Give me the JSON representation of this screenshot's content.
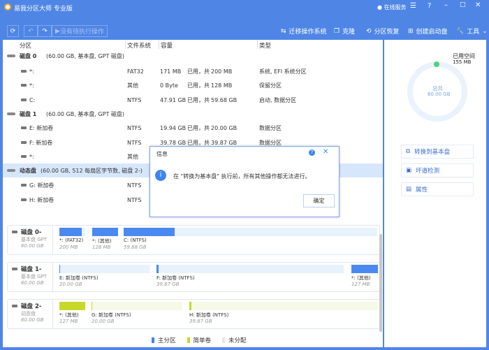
{
  "app": {
    "title": "易我分区大师 专业版",
    "online_service": "在线服务"
  },
  "toolbar": {
    "pending": "没有待执行操作",
    "migrate": "迁移操作系统",
    "clone": "克隆",
    "recover": "分区恢复",
    "bootdisk": "创建启动盘",
    "tools": "工具"
  },
  "columns": [
    "分区",
    "文件系统",
    "容量",
    "类型"
  ],
  "rows": [
    {
      "kind": "disk",
      "name": "磁盘 0",
      "info": "(60.00 GB, 基本盘, GPT 磁盘)"
    },
    {
      "kind": "part",
      "name": "*:",
      "fs": "FAT32",
      "used": "171 MB",
      "mid": "已用，共",
      "total": "200 MB",
      "type": "系统, EFI 系统分区"
    },
    {
      "kind": "part",
      "name": "*:",
      "fs": "其他",
      "used": "0 Byte",
      "mid": "已用，共",
      "total": "128 MB",
      "type": "保留分区"
    },
    {
      "kind": "part",
      "name": "C:",
      "fs": "NTFS",
      "used": "47.91 GB",
      "mid": "已用，共",
      "total": "59.68 GB",
      "type": "启动, 数据分区"
    },
    {
      "kind": "disk",
      "name": "磁盘 1",
      "info": "(60.00 GB, 基本盘, GPT 磁盘)"
    },
    {
      "kind": "part",
      "name": "E: 新加卷",
      "fs": "NTFS",
      "used": "19.94 GB",
      "mid": "已用，共",
      "total": "20.00 GB",
      "type": "数据分区"
    },
    {
      "kind": "part",
      "name": "F: 新加卷",
      "fs": "NTFS",
      "used": "39.78 GB",
      "mid": "已用，共",
      "total": "39.87 GB",
      "type": "数据分区"
    },
    {
      "kind": "part",
      "name": "*:",
      "fs": "其他",
      "used": "",
      "mid": "",
      "total": "",
      "type": ""
    },
    {
      "kind": "disk",
      "name": "动态盘",
      "info": "(60.00 GB, 512 每扇区字节数, 磁盘 2-)",
      "selected": true
    },
    {
      "kind": "part",
      "name": "G: 新加卷",
      "fs": "NTFS",
      "used": "",
      "mid": "",
      "total": "",
      "type": ""
    },
    {
      "kind": "part",
      "name": "H: 新加卷",
      "fs": "NTFS",
      "used": "",
      "mid": "",
      "total": "",
      "type": ""
    }
  ],
  "disks": [
    {
      "name": "磁盘 0-",
      "type": "基本盘 GPT",
      "size": "60.00 GB",
      "segs": [
        {
          "label": "*: (FAT32)",
          "size": "200 MB",
          "color": "#4a8af0",
          "bg": "#e8f2fd",
          "fill": 0.86
        },
        {
          "label": "*: (其他)",
          "size": "128 MB",
          "color": "#4a8af0",
          "bg": "#e8f2fd",
          "fill": 1
        },
        {
          "label": "C: (NTFS)",
          "size": "59.68 GB",
          "color": "#4a8af0",
          "bg": "#e8f2fd",
          "fill": 0.2
        }
      ]
    },
    {
      "name": "磁盘 1-",
      "type": "基本盘 GPT",
      "size": "60.00 GB",
      "segs": [
        {
          "label": "E: 新加卷 (NTFS)",
          "size": "20.00 GB",
          "color": "#4a8af0",
          "bg": "#e8f2fd",
          "fill": 0.01
        },
        {
          "label": "F: 新加卷 (NTFS)",
          "size": "39.87 GB",
          "color": "#4a8af0",
          "bg": "#e8f2fd",
          "fill": 0.01
        },
        {
          "label": "*: (其他)",
          "size": "127 MB",
          "color": "#4a8af0",
          "bg": "#e8f2fd",
          "fill": 1
        }
      ]
    },
    {
      "name": "磁盘 2-",
      "type": "动态盘",
      "size": "60.00 GB",
      "segs": [
        {
          "label": "*: (其他)",
          "size": "127 MB",
          "color": "#c8d82a",
          "bg": "#f6f9e6",
          "fill": 1
        },
        {
          "label": "G: 新加卷 (NTFS)",
          "size": "20.00 GB",
          "color": "#c8d82a",
          "bg": "#f6f9e6",
          "fill": 0.01
        },
        {
          "label": "H: 新加卷 (NTFS)",
          "size": "39.87 GB",
          "color": "#c8d82a",
          "bg": "#f6f9e6",
          "fill": 0.01
        }
      ]
    }
  ],
  "legend": [
    {
      "label": "主分区",
      "color": "#3d85f0"
    },
    {
      "label": "简单卷",
      "color": "#c8d82a"
    },
    {
      "label": "未分配",
      "color": "#e6e6e6"
    }
  ],
  "usage": {
    "used_label": "已用空间",
    "used": "155 MB",
    "total_label": "总共",
    "total": "60.00 GB",
    "used_fraction": 0.0025
  },
  "actions": [
    "转换到基本盘",
    "坏道检测",
    "属性"
  ],
  "dialog": {
    "title": "信息",
    "message": "在 \"转换为基本盘\" 执行前，所有其他操作都无法进行。",
    "ok": "确定"
  }
}
